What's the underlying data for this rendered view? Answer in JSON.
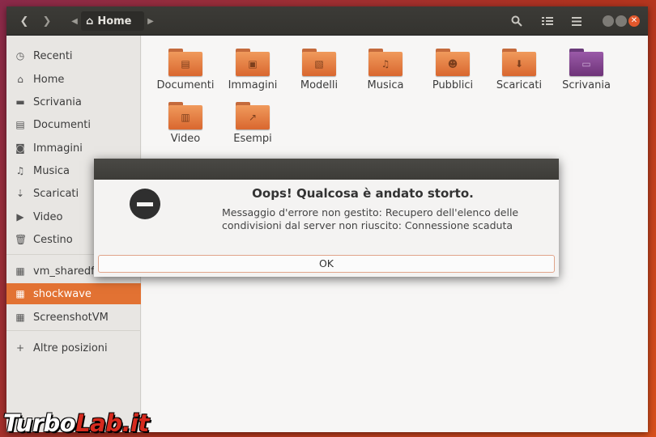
{
  "header": {
    "path_label": "Home"
  },
  "sidebar": {
    "items": [
      {
        "label": "Recenti",
        "icon": "clock-icon"
      },
      {
        "label": "Home",
        "icon": "home-icon"
      },
      {
        "label": "Scrivania",
        "icon": "folder-icon"
      },
      {
        "label": "Documenti",
        "icon": "document-icon"
      },
      {
        "label": "Immagini",
        "icon": "camera-icon"
      },
      {
        "label": "Musica",
        "icon": "music-icon"
      },
      {
        "label": "Scaricati",
        "icon": "download-icon"
      },
      {
        "label": "Video",
        "icon": "video-icon"
      },
      {
        "label": "Cestino",
        "icon": "trash-icon"
      },
      {
        "label": "vm_sharedfolder",
        "icon": "network-icon"
      },
      {
        "label": "shockwave",
        "icon": "network-icon",
        "active": true
      },
      {
        "label": "ScreenshotVM",
        "icon": "network-icon"
      },
      {
        "label": "Altre posizioni",
        "icon": "plus-icon"
      }
    ]
  },
  "folders": [
    {
      "label": "Documenti",
      "icon": "document-emblem"
    },
    {
      "label": "Immagini",
      "icon": "image-emblem"
    },
    {
      "label": "Modelli",
      "icon": "template-emblem"
    },
    {
      "label": "Musica",
      "icon": "music-emblem"
    },
    {
      "label": "Pubblici",
      "icon": "person-emblem"
    },
    {
      "label": "Scaricati",
      "icon": "download-emblem"
    },
    {
      "label": "Scrivania",
      "icon": "desktop-emblem"
    },
    {
      "label": "Video",
      "icon": "film-emblem"
    },
    {
      "label": "Esempi",
      "icon": "link-emblem"
    }
  ],
  "dialog": {
    "title": "Oops! Qualcosa è andato storto.",
    "message": "Messaggio d'errore non gestito: Recupero dell'elenco delle condivisioni dal server non riuscito: Connessione scaduta",
    "ok_label": "OK"
  },
  "watermark": {
    "part1": "Turbo",
    "part2": "Lab.it"
  },
  "colors": {
    "accent": "#e27233",
    "folder": "#e8834a",
    "desktop_folder": "#8a4a98"
  }
}
